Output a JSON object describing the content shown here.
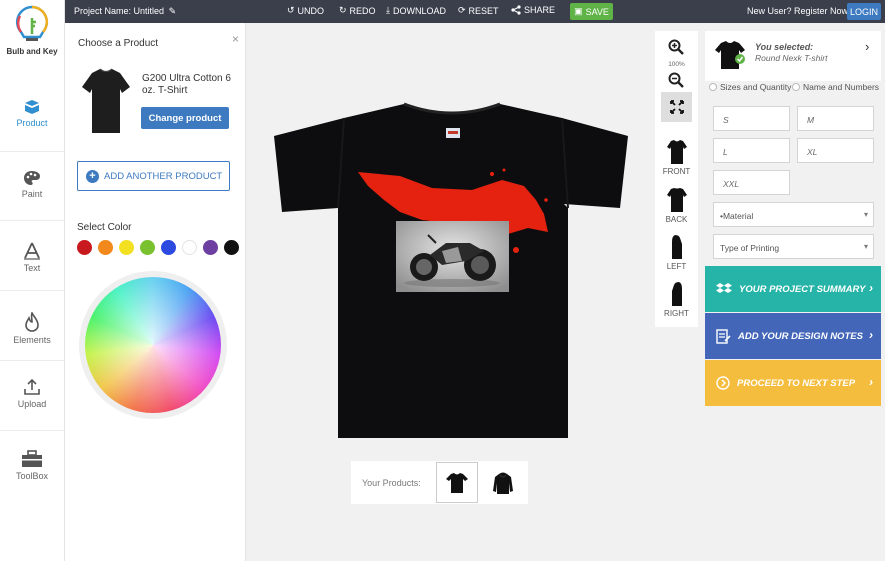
{
  "topbar": {
    "project_name": "Project Name: Untitled",
    "undo": "UNDO",
    "redo": "REDO",
    "download": "DOWNLOAD",
    "reset": "RESET",
    "share": "SHARE",
    "save": "SAVE",
    "register": "New User? Register Now",
    "login": "LOGIN"
  },
  "brand": {
    "name": "Bulb and Key"
  },
  "sidebar": {
    "items": [
      {
        "label": "Product"
      },
      {
        "label": "Paint"
      },
      {
        "label": "Text"
      },
      {
        "label": "Elements"
      },
      {
        "label": "Upload"
      },
      {
        "label": "ToolBox"
      }
    ]
  },
  "product_panel": {
    "title": "Choose a Product",
    "close": "×",
    "product_name": "G200 Ultra Cotton 6 oz. T-Shirt",
    "change_button": "Change product",
    "add_button": "ADD ANOTHER PRODUCT",
    "select_color_label": "Select Color",
    "colors": [
      "#c8191e",
      "#f1891c",
      "#f3e021",
      "#79c12e",
      "#2c49e0",
      "#ffffff",
      "#6d3fa0",
      "#111111"
    ]
  },
  "view": {
    "zoom": "100%",
    "views": [
      {
        "label": "FRONT"
      },
      {
        "label": "BACK"
      },
      {
        "label": "LEFT"
      },
      {
        "label": "RIGHT"
      }
    ]
  },
  "selection": {
    "label": "You selected:",
    "name": "Round Nexk T-shirt"
  },
  "options": {
    "sizes": "Sizes and Quantity",
    "names": "Name and Numbers"
  },
  "sizes": [
    "S",
    "M",
    "L",
    "XL",
    "XXL"
  ],
  "material_select": "•Material",
  "printing_select": "Type of Printing",
  "actions": {
    "summary": "YOUR PROJECT SUMMARY",
    "notes": "ADD YOUR DESIGN NOTES",
    "proceed": "PROCEED TO NEXT STEP"
  },
  "products_strip": {
    "label": "Your Products:"
  },
  "theme": {
    "accent": "#3d7ac0",
    "save_green": "#5fb347",
    "summary_teal": "#27b4a8",
    "notes_blue": "#4366b8",
    "proceed_yellow": "#f5bd3e",
    "topbar": "#3a3f4b"
  }
}
